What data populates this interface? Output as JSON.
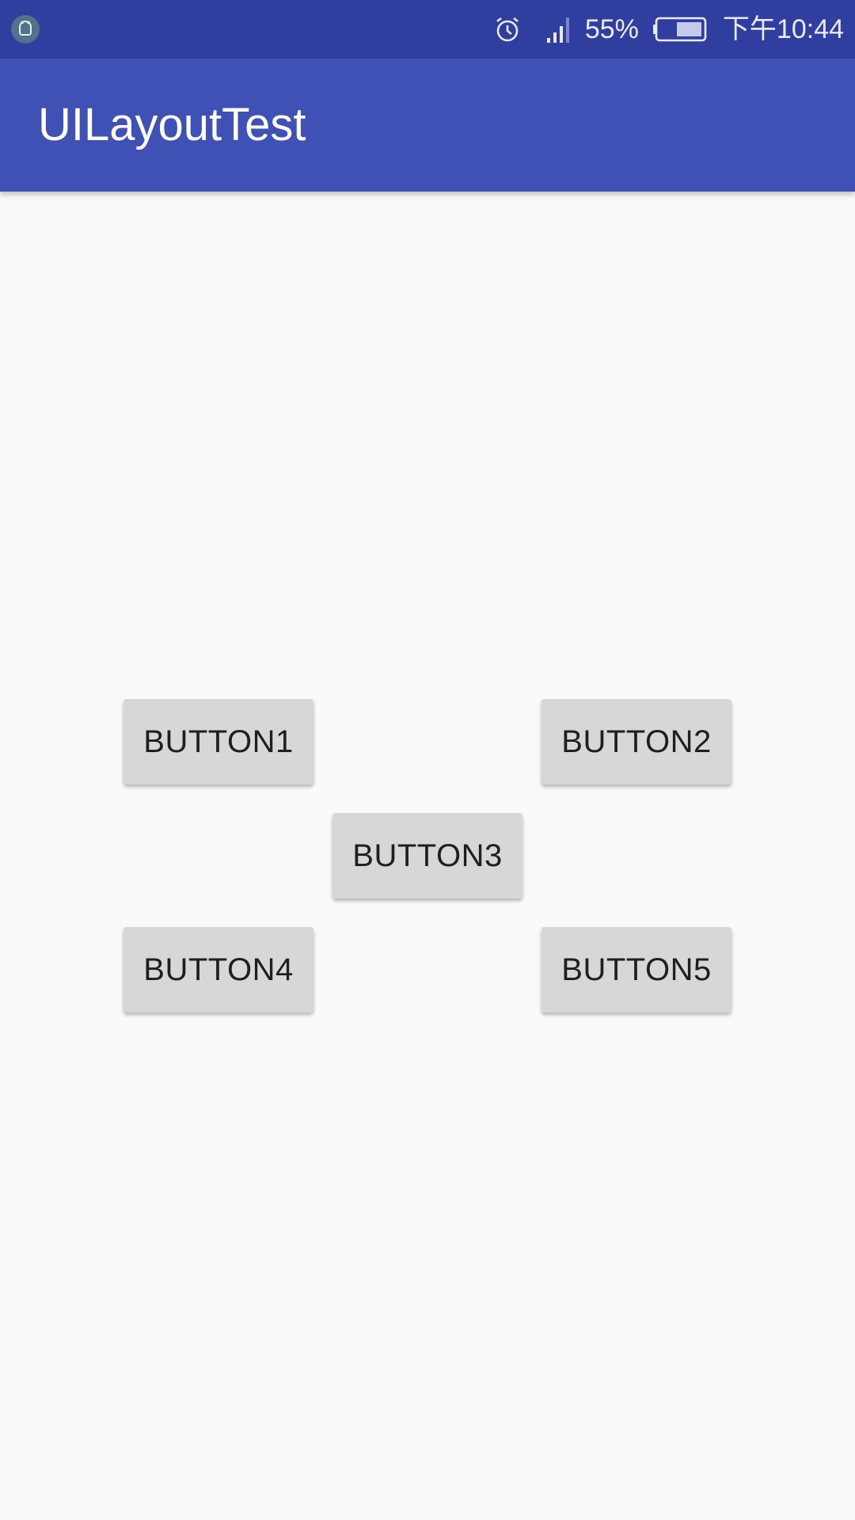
{
  "status_bar": {
    "notification_icon": "android-debug-icon",
    "alarm_icon": "alarm-icon",
    "signal_icon": "signal-icon",
    "battery_percent": "55%",
    "battery_level": 0.55,
    "time": "下午10:44",
    "background_color": "#303f9f"
  },
  "app_bar": {
    "title": "UILayoutTest",
    "background_color": "#3f51b5"
  },
  "buttons": [
    {
      "label": "BUTTON1"
    },
    {
      "label": "BUTTON2"
    },
    {
      "label": "BUTTON3"
    },
    {
      "label": "BUTTON4"
    },
    {
      "label": "BUTTON5"
    }
  ]
}
